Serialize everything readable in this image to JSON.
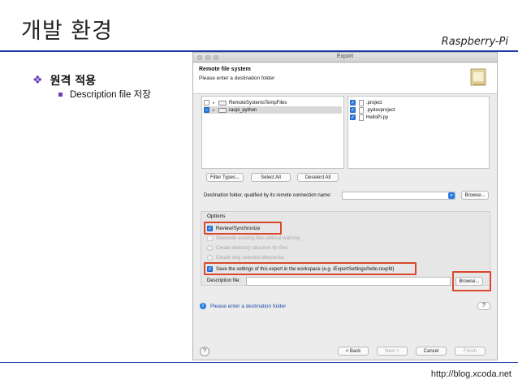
{
  "slide": {
    "title": "개발 환경",
    "subtitle": "Raspberry-Pi",
    "bullet_main": "원격 적용",
    "bullet_sub": "Description file 저장",
    "footer": "http://blog.xcoda.net"
  },
  "colors": {
    "rule": "#1e3ca8",
    "bullet": "#6c3fb7",
    "highlight": "#d9472d",
    "checkbox": "#2b7ae4"
  },
  "dialog": {
    "window_title": "Export",
    "header_title": "Remote file system",
    "header_message": "Please enter a destination folder",
    "header_icon": "folder-icon",
    "tree_items": [
      {
        "label": "RemoteSystemsTempFiles",
        "state": "unchecked"
      },
      {
        "label": "raspi_python",
        "state": "mixed"
      }
    ],
    "file_items": [
      {
        "label": ".project",
        "checked": true
      },
      {
        "label": ".pydevproject",
        "checked": true
      },
      {
        "label": "HelloPi.py",
        "checked": true
      }
    ],
    "filter_button": "Filter Types...",
    "select_all_button": "Select All",
    "deselect_all_button": "Deselect All",
    "destination_label": "Destination folder, qualified by its remote connection name:",
    "destination_value": "",
    "browse_button": "Browse...",
    "options_label": "Options",
    "options": [
      {
        "label": "Review/Synchronize",
        "type": "checkbox",
        "checked": true,
        "enabled": true
      },
      {
        "label": "Overwrite existing files without warning",
        "type": "checkbox",
        "checked": false,
        "enabled": false
      },
      {
        "label": "Create directory structure for files",
        "type": "radio",
        "enabled": false
      },
      {
        "label": "Create only selected directories",
        "type": "radio",
        "enabled": false
      },
      {
        "label": "Save the settings of this export in the workspace (e.g. /ExportSettings/hello.rexpfd)",
        "type": "checkbox",
        "checked": true,
        "enabled": true
      }
    ],
    "description_label": "Description file:",
    "description_value": "",
    "description_browse_button": "Browse...",
    "status_message": "Please enter a destination folder",
    "help_glyph": "?",
    "buttons": {
      "back": "< Back",
      "next": "Next >",
      "cancel": "Cancel",
      "finish": "Finish"
    }
  }
}
